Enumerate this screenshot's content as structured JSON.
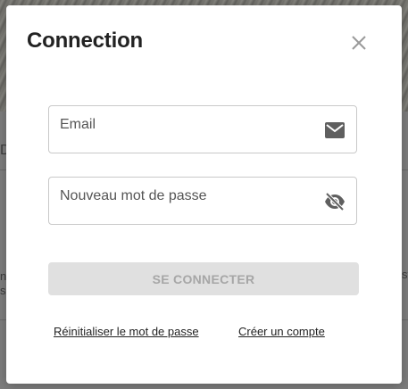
{
  "modal": {
    "title": "Connection",
    "close_icon": "close-icon"
  },
  "form": {
    "email": {
      "label": "Email",
      "value": "",
      "icon": "mail-icon"
    },
    "password": {
      "label": "Nouveau mot de passe",
      "value": "",
      "icon": "eye-off-icon"
    },
    "submit_label": "SE CONNECTER"
  },
  "links": {
    "reset_password": "Réinitialiser le mot de passe",
    "create_account": "Créer un compte"
  },
  "background": {
    "left_letter": "D",
    "left_partial": "n\ns",
    "right_partial": "st"
  },
  "colors": {
    "button_disabled_bg": "#e0e0e0",
    "button_disabled_text": "#a6a6a6",
    "title": "#222222",
    "field_border": "#c9c9c9"
  }
}
